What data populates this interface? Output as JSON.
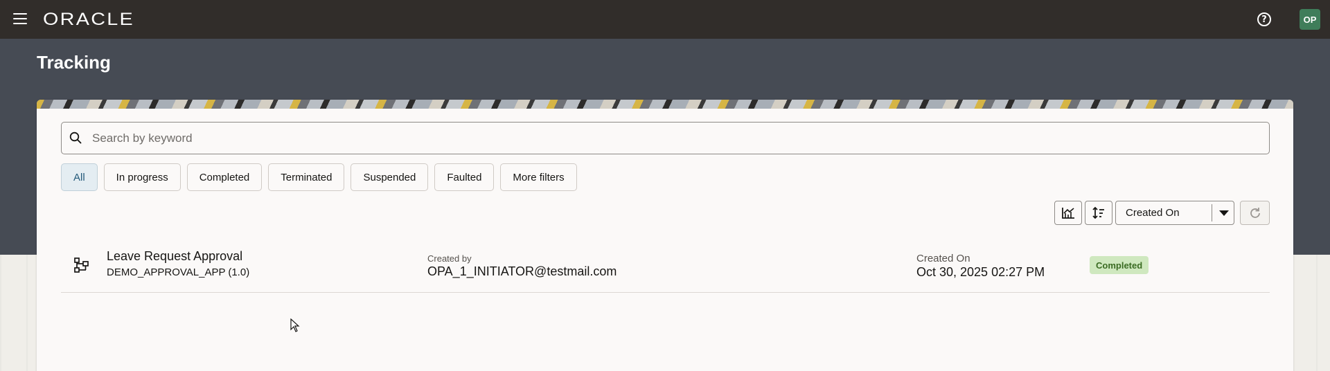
{
  "topbar": {
    "logo": "ORACLE",
    "help": "?",
    "avatar_initials": "OP"
  },
  "page": {
    "title": "Tracking"
  },
  "search": {
    "placeholder": "Search by keyword",
    "value": ""
  },
  "filters": [
    {
      "label": "All",
      "active": true
    },
    {
      "label": "In progress",
      "active": false
    },
    {
      "label": "Completed",
      "active": false
    },
    {
      "label": "Terminated",
      "active": false
    },
    {
      "label": "Suspended",
      "active": false
    },
    {
      "label": "Faulted",
      "active": false
    },
    {
      "label": "More filters",
      "active": false
    }
  ],
  "toolbar": {
    "chart_icon": "chart-icon",
    "sort_icon": "sort-icon",
    "sort_by": "Created On",
    "refresh_icon": "refresh-icon"
  },
  "results": [
    {
      "icon": "process-flow-icon",
      "title": "Leave Request Approval",
      "subtitle": "DEMO_APPROVAL_APP (1.0)",
      "created_by_label": "Created by",
      "created_by": "OPA_1_INITIATOR@testmail.com",
      "created_on_label": "Created On",
      "created_on": "Oct 30, 2025 02:27 PM",
      "status": "Completed"
    }
  ],
  "colors": {
    "topbar": "#312d2a",
    "header_band": "#464b54",
    "card": "#fbf9f8",
    "active_chip": "#e4edf2",
    "badge_bg": "#cfe8bf",
    "badge_text": "#3a6b22",
    "avatar": "#3f7d5a"
  }
}
